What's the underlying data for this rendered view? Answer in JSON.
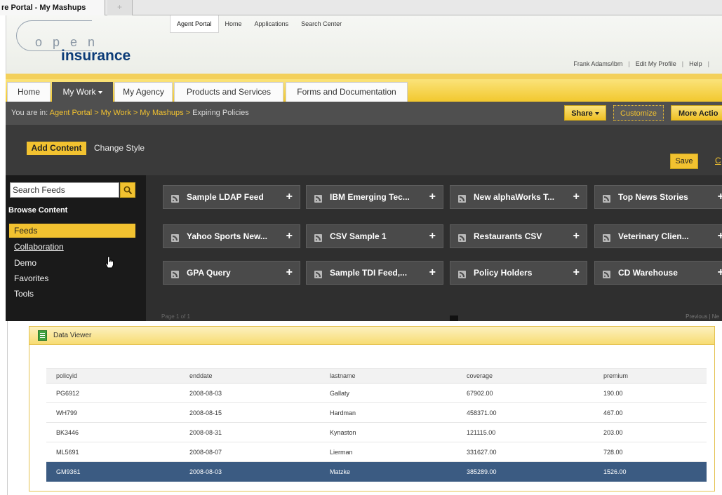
{
  "browser": {
    "tab_title": "re Portal - My Mashups",
    "new_tab_label": "+"
  },
  "header": {
    "logo": {
      "top": "o p e n",
      "bottom": "insurance"
    },
    "nav": [
      "Agent Portal",
      "Home",
      "Applications",
      "Search Center"
    ],
    "nav_selected": "Agent Portal",
    "user_links": [
      "Frank Adams/ibm",
      "Edit My Profile",
      "Help"
    ],
    "separator": "|"
  },
  "tabs": [
    "Home",
    "My Work",
    "My Agency",
    "Products and Services",
    "Forms and Documentation"
  ],
  "active_tab": "My Work",
  "breadcrumb": {
    "prefix": "You are in:",
    "links": [
      "Agent Portal",
      "My Work",
      "My Mashups"
    ],
    "current": "Expiring Policies",
    "separator": ">"
  },
  "page_actions": {
    "share": "Share",
    "customize": "Customize",
    "more": "More Actio"
  },
  "edit_bar": {
    "add_content": "Add Content",
    "change_style": "Change Style",
    "save": "Save",
    "save_more": "C"
  },
  "sidebar": {
    "search_placeholder": "Search Feeds",
    "browse_heading": "Browse Content",
    "items": [
      "Feeds",
      "Collaboration",
      "Demo",
      "Favorites",
      "Tools"
    ],
    "selected": "Feeds"
  },
  "feeds": [
    "Sample LDAP Feed",
    "IBM Emerging Tec...",
    "New alphaWorks T...",
    "Top News Stories",
    "Yahoo Sports New...",
    "CSV Sample 1",
    "Restaurants CSV",
    "Veterinary Clien...",
    "GPA Query",
    "Sample TDI Feed,...",
    "Policy Holders",
    "CD Warehouse"
  ],
  "feed_add_glyph": "+",
  "pager": {
    "left": "Page 1 of 1",
    "page": "1",
    "right": "Previous | Ne"
  },
  "data_viewer": {
    "title": "Data Viewer",
    "columns": [
      "policyid",
      "enddate",
      "lastname",
      "coverage",
      "premium"
    ],
    "rows": [
      [
        "PG6912",
        "2008-08-03",
        "Gallaty",
        "67902.00",
        "190.00"
      ],
      [
        "WH799",
        "2008-08-15",
        "Hardman",
        "458371.00",
        "467.00"
      ],
      [
        "BK3446",
        "2008-08-31",
        "Kynaston",
        "121115.00",
        "203.00"
      ],
      [
        "ML5691",
        "2008-08-07",
        "Lierman",
        "331627.00",
        "728.00"
      ],
      [
        "GM9361",
        "2008-08-03",
        "Matzke",
        "385289.00",
        "1526.00"
      ]
    ],
    "selected_row": 4
  },
  "colors": {
    "accent": "#f2c230",
    "dark": "#3a3a3a",
    "selection": "#3b5b82"
  }
}
